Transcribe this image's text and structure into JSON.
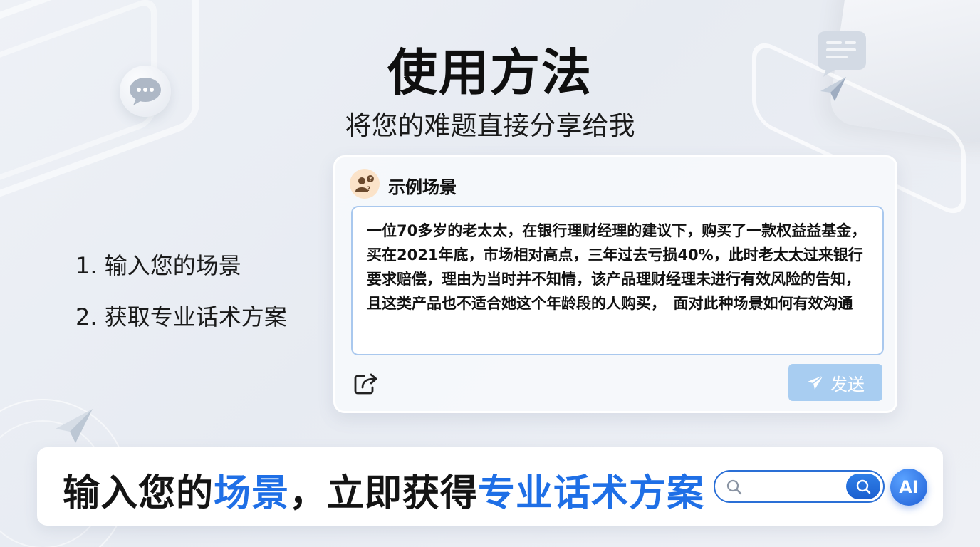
{
  "header": {
    "title": "使用方法",
    "subtitle": "将您的难题直接分享给我"
  },
  "steps": [
    {
      "label": "1. 输入您的场景"
    },
    {
      "label": "2. 获取专业话术方案"
    }
  ],
  "card": {
    "title": "示例场景",
    "text": "一位70多岁的老太太，在银行理财经理的建议下，购买了一款权益益基金，买在2021年底，市场相对高点，三年过去亏损40%，此时老太太过来银行要求赔偿，理由为当时并不知情，该产品理财经理未进行有效风险的告知，且这类产品也不适合她这个年龄段的人购买，　面对此种场景如何有效沟通",
    "send_label": "发送"
  },
  "banner": {
    "part1": "输入您的",
    "part2": "场景",
    "part3": "，立即获得",
    "part4": "专业话术方案",
    "ai_label": "AI"
  },
  "icons": {
    "chat_bubble_left": "chat-bubble-icon",
    "message_right": "message-icon",
    "paper_plane": "paper-plane-icon",
    "share": "share-icon",
    "send": "send-icon",
    "search": "search-icon",
    "avatar": "user-question-icon"
  },
  "colors": {
    "accent_blue": "#1f6fe6",
    "send_button": "#a8cdf1",
    "textarea_border": "#a9c8ee",
    "avatar_bg": "#fbe3c9"
  }
}
